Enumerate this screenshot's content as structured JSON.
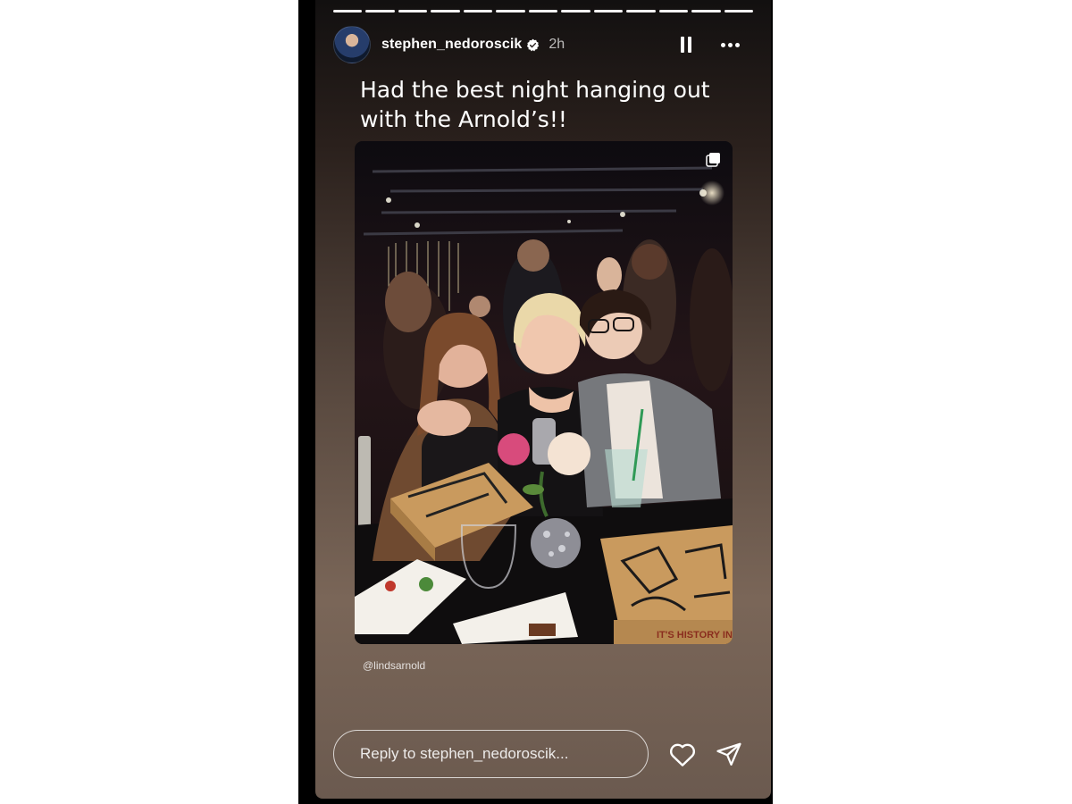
{
  "story": {
    "segments_count": 13,
    "username": "stephen_nedoroscik",
    "time_ago": "2h",
    "caption": "Had the best night hanging out with the Arnold’s!!",
    "mention": "@lindsarnold",
    "reply_placeholder": "Reply to stephen_nedoroscik..."
  },
  "icons": {
    "verified": "verified-badge-icon",
    "pause": "pause-icon",
    "more": "more-options-icon",
    "carousel": "multiple-photos-icon",
    "like": "heart-icon",
    "share": "send-icon"
  },
  "photo": {
    "pizza_box_text": "IT'S HISTORY IN"
  },
  "colors": {
    "text": "#ffffff",
    "background": "#000000"
  }
}
